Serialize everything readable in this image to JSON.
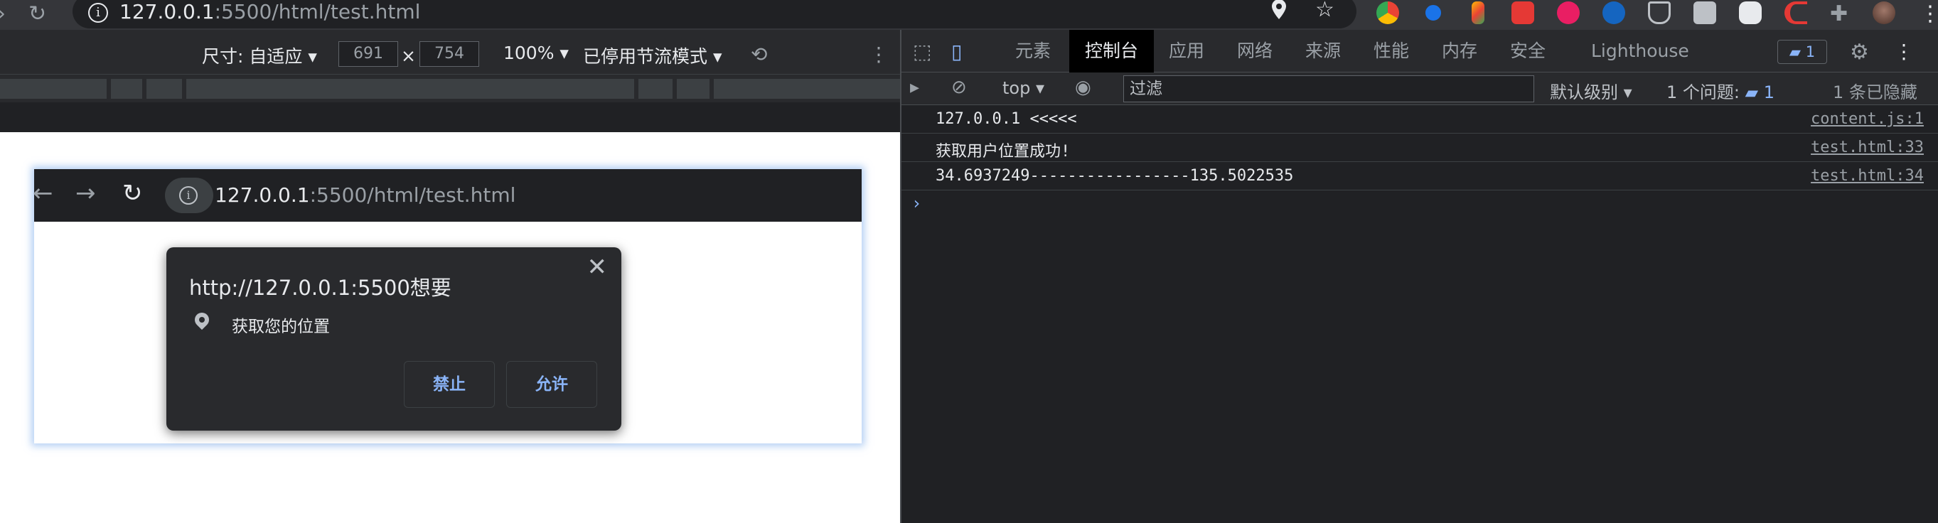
{
  "browser": {
    "url_host": "127.0.0.1",
    "url_path": ":5500/html/test.html"
  },
  "device_toolbar": {
    "dimensions_label": "尺寸: 自适应",
    "width": "691",
    "times": "×",
    "height": "754",
    "zoom": "100%",
    "throttle": "已停用节流模式"
  },
  "emulated_page": {
    "url_host": "127.0.0.1",
    "url_path": ":5500/html/test.html",
    "permission_prompt": {
      "title": "http://127.0.0.1:5500想要",
      "request": "获取您的位置",
      "block_label": "禁止",
      "allow_label": "允许",
      "close": "✕"
    }
  },
  "devtools": {
    "tabs": [
      {
        "label": "元素"
      },
      {
        "label": "控制台"
      },
      {
        "label": "应用"
      },
      {
        "label": "网络"
      },
      {
        "label": "来源"
      },
      {
        "label": "性能"
      },
      {
        "label": "内存"
      },
      {
        "label": "安全"
      },
      {
        "label": "Lighthouse"
      }
    ],
    "active_tab": "控制台",
    "issue_badge": "1",
    "filter_bar": {
      "context": "top",
      "filter_placeholder": "过滤",
      "level": "默认级别",
      "issues_label": "1 个问题:",
      "issues_count": "1",
      "hidden_label": "1 条已隐藏"
    },
    "console": [
      {
        "message": "127.0.0.1 <<<<<",
        "source": "content.js:1"
      },
      {
        "message": "获取用户位置成功!",
        "source": "test.html:33"
      },
      {
        "message": "34.6937249-----------------135.5022535",
        "source": "test.html:34"
      }
    ],
    "prompt": "›"
  },
  "colors": {
    "accent_blue": "#8ab4f8",
    "panel_dark": "#202124",
    "toolbar_dark": "#292a2d"
  }
}
